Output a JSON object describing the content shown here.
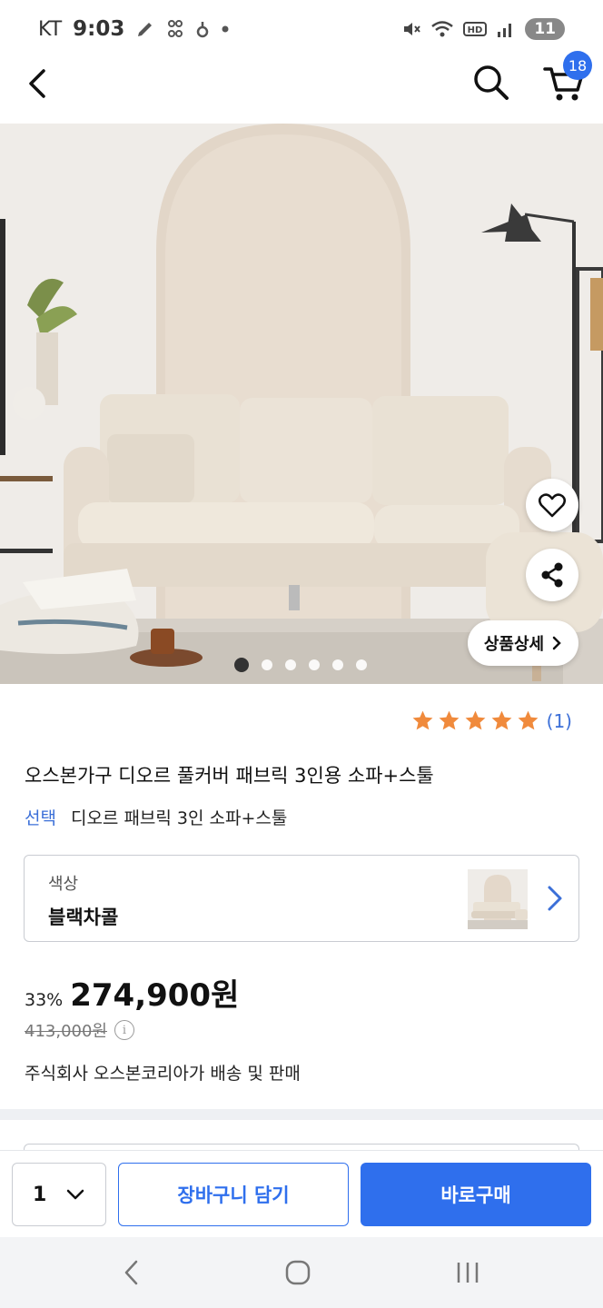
{
  "status_bar": {
    "carrier": "KT",
    "time": "9:03",
    "battery": "11",
    "left_icons": [
      "pen-icon",
      "dots-icon",
      "lock-icon",
      "dot-icon"
    ],
    "right_icons": [
      "mute-icon",
      "wifi-icon",
      "hd-icon",
      "signal-icon"
    ]
  },
  "header": {
    "cart_count": "18",
    "icons": [
      "back-icon",
      "search-icon",
      "cart-icon"
    ]
  },
  "hero": {
    "detail_button": "상품상세",
    "slide_count": 6,
    "active_slide": 1,
    "icons": [
      "heart-icon",
      "share-icon",
      "chevron-right-icon"
    ]
  },
  "rating": {
    "stars": 5,
    "count": "(1)"
  },
  "product": {
    "title": "오스본가구 디오르 풀커버 패브릭 3인용 소파+스툴",
    "option_label": "선택",
    "option_value": "디오르 패브릭 3인 소파+스툴"
  },
  "color_select": {
    "label": "색상",
    "value": "블랙차콜"
  },
  "price": {
    "discount": "33%",
    "sale_price": "274,900원",
    "original_price": "413,000원",
    "seller": "주식회사 오스본코리아가 배송 및 판매"
  },
  "bottom_bar": {
    "quantity": "1",
    "add_to_cart": "장바구니 담기",
    "buy_now": "바로구매"
  },
  "colors": {
    "accent": "#2f6fed",
    "star": "#f08a3c",
    "link": "#3b6fd8"
  }
}
